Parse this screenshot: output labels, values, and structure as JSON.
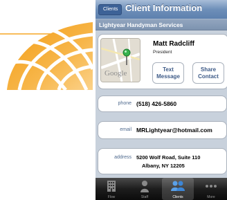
{
  "nav": {
    "back_label": "Clients",
    "title": "Client Information"
  },
  "section_title": "Lightyear Handyman Services",
  "contact": {
    "name": "Matt Radcliff",
    "role": "President",
    "map_logo": "Google",
    "text_button": [
      "Text",
      "Message"
    ],
    "share_button": [
      "Share",
      "Contact"
    ]
  },
  "phone": {
    "label": "phone",
    "value": "(518) 426-5860"
  },
  "email": {
    "label": "email",
    "value": "MRLightyear@hotmail.com"
  },
  "address": {
    "label": "address",
    "line1": "5200 Wolf Road, Suite 110",
    "line2": "Albany, NY 12205"
  },
  "tabs": [
    {
      "label": "Flow",
      "icon": "building-icon",
      "active": false
    },
    {
      "label": "Staff",
      "icon": "person-icon",
      "active": false
    },
    {
      "label": "Clients",
      "icon": "people-icon",
      "active": true
    },
    {
      "label": "More",
      "icon": "more-icon",
      "active": false
    }
  ],
  "colors": {
    "accent": "#f5a623",
    "nav_blue": "#5d80ae",
    "label_blue": "#4f6a8e",
    "background": "#c8d1dc"
  }
}
